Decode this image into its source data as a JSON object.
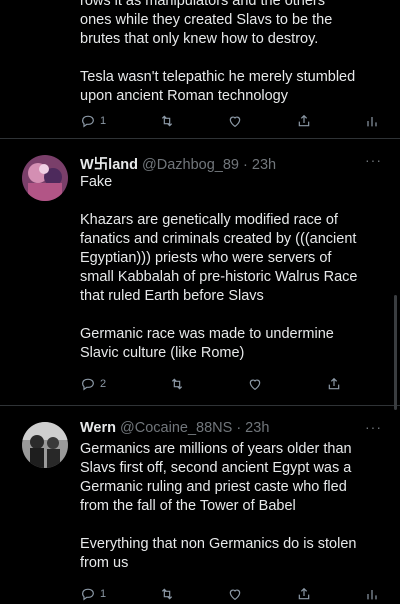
{
  "tweet1": {
    "partial_line": "rows it as manipulators and the others",
    "lines_a": [
      "ones while they created Slavs to be the",
      "brutes that only knew how to destroy."
    ],
    "lines_b": [
      "Tesla wasn't telepathic he merely stumbled",
      "upon ancient Roman technology"
    ],
    "reply_count": "1"
  },
  "tweet2": {
    "name": "W卐land",
    "handle": "@Dazhbog_89",
    "time": "· 23h",
    "more": "···",
    "line_fake": "Fake",
    "para1": [
      "Khazars are genetically modified race of",
      "fanatics and criminals created by (((ancient",
      "Egyptian))) priests who were servers of",
      "small Kabbalah of pre-historic Walrus Race",
      "that ruled Earth before Slavs"
    ],
    "para2": [
      "Germanic race was made to undermine",
      "Slavic culture (like Rome)"
    ],
    "reply_count": "2"
  },
  "tweet3": {
    "name": "Wern",
    "handle": "@Cocaine_88NS",
    "time": "· 23h",
    "more": "···",
    "para1": [
      "Germanics are millions of years older than",
      "Slavs first off, second ancient Egypt was a",
      "Germanic ruling and priest caste who fled",
      "from the fall of the Tower of Babel"
    ],
    "para2": [
      "Everything that non Germanics do is stolen",
      "from us"
    ],
    "reply_count": "1"
  },
  "icons": [
    "reply-icon",
    "retweet-icon",
    "like-icon",
    "share-icon",
    "analytics-icon"
  ]
}
